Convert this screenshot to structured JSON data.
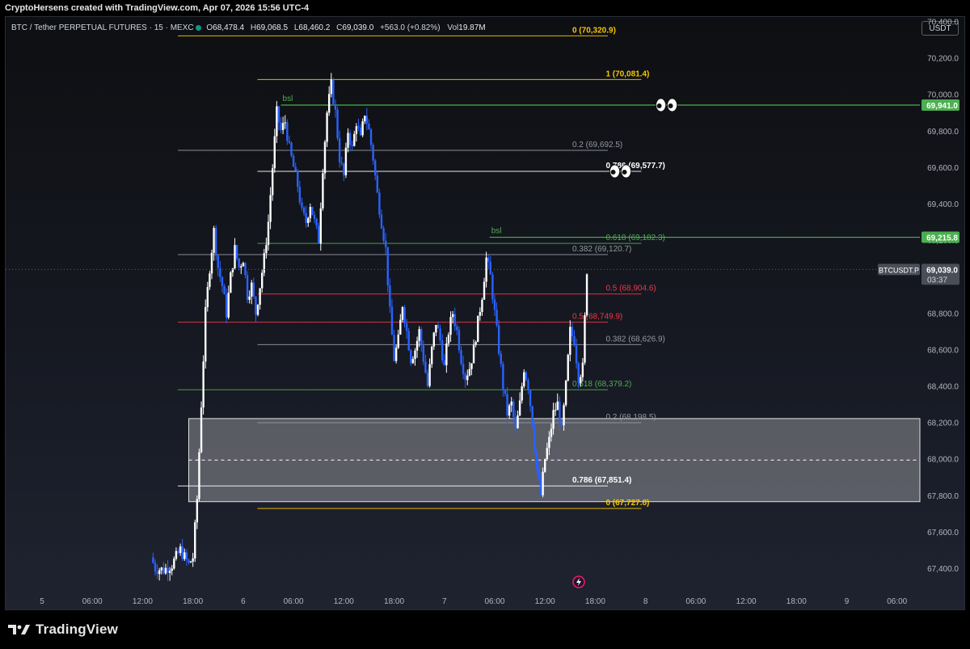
{
  "attribution": "CryptoHersens created with TradingView.com, Apr 07, 2026 15:56 UTC-4",
  "symbol_bar": {
    "symbol": "BTC / Tether PERPETUAL FUTURES · 15 · MEXC",
    "open_label": "O",
    "open": "68,478.4",
    "high_label": "H",
    "high": "69,068.5",
    "low_label": "L",
    "low": "68,460.2",
    "close_label": "C",
    "close": "69,039.0",
    "change": "+563.0 (+0.82%)",
    "vol_label": "Vol",
    "volume": "19.87M"
  },
  "currency": "USDT",
  "logo_text": "TradingView",
  "colors": {
    "candle_up": "#ffffff",
    "candle_down": "#2962ff",
    "fib_yellow": "#f7c600",
    "fib_green": "#4caf50",
    "fib_red": "#f23645",
    "fib_gray": "#9598a1",
    "price_tag_green": "#4caf50"
  },
  "chart_data": {
    "type": "candlestick",
    "title": "BTC / Tether PERPETUAL FUTURES · 15 · MEXC",
    "interval": "15m",
    "x_tick_labels": [
      "5",
      "06:00",
      "12:00",
      "18:00",
      "6",
      "06:00",
      "12:00",
      "18:00",
      "7",
      "06:00",
      "12:00",
      "18:00",
      "8",
      "06:00",
      "12:00",
      "18:00",
      "9",
      "06:00"
    ],
    "y_tick_labels": [
      "70,400.0",
      "70,200.0",
      "70,000.0",
      "69,800.0",
      "69,600.0",
      "69,400.0",
      "69,200.0",
      "69,000.0",
      "68,800.0",
      "68,600.0",
      "68,400.0",
      "68,200.0",
      "68,000.0",
      "67,800.0",
      "67,600.0",
      "67,400.0"
    ],
    "ylim": [
      67320,
      70480
    ],
    "xlim_hours": [
      0,
      102
    ],
    "current_price": {
      "symbol": "BTCUSDT.P",
      "price": "69,039.0",
      "countdown": "03:37",
      "value": 69039.0
    },
    "price_tags": [
      {
        "label": "69,941.0",
        "value": 69941.0
      },
      {
        "label": "69,215.8",
        "value": 69215.8
      }
    ],
    "horizontal_lines": [
      {
        "label": "bsl",
        "value": 69941.0,
        "color": "green",
        "from_hour": 28.5
      },
      {
        "label": "bsl",
        "value": 69215.8,
        "color": "green",
        "from_hour": 53.4
      }
    ],
    "fib_levels": [
      {
        "label": "0 (70,320.9)",
        "value": 70320.9,
        "color": "yellow",
        "x1": 16.2,
        "x2": 67.5
      },
      {
        "label": "1 (70,081.4)",
        "value": 70081.4,
        "color": "yellow",
        "x1": 25.7,
        "x2": 71.5
      },
      {
        "label": "0.2 (69,692.5)",
        "value": 69692.5,
        "color": "gray",
        "x1": 16.2,
        "x2": 67.5
      },
      {
        "label": "0.786 (69,577.7)",
        "value": 69577.7,
        "color": "white",
        "x1": 25.7,
        "x2": 71.5
      },
      {
        "label": "0.618 (69,182.3)",
        "value": 69182.3,
        "color": "green",
        "x1": 25.7,
        "x2": 71.5
      },
      {
        "label": "0.382 (69,120.7)",
        "value": 69120.7,
        "color": "gray",
        "x1": 16.2,
        "x2": 67.5
      },
      {
        "label": "0.5 (68,904.6)",
        "value": 68904.6,
        "color": "red",
        "x1": 25.7,
        "x2": 71.5
      },
      {
        "label": "0.5 (68,749.9)",
        "value": 68749.9,
        "color": "red",
        "x1": 16.2,
        "x2": 67.5
      },
      {
        "label": "0.382 (68,626.9)",
        "value": 68626.9,
        "color": "gray",
        "x1": 25.7,
        "x2": 71.5
      },
      {
        "label": "0.618 (68,379.2)",
        "value": 68379.2,
        "color": "green",
        "x1": 16.2,
        "x2": 67.5
      },
      {
        "label": "0.2 (68,198.5)",
        "value": 68198.5,
        "color": "gray",
        "x1": 25.7,
        "x2": 71.5
      },
      {
        "label": "0.786 (67,851.4)",
        "value": 67851.4,
        "color": "white",
        "x1": 16.2,
        "x2": 67.5
      },
      {
        "label": "0 (67,727.8)",
        "value": 67727.8,
        "color": "yellow",
        "x1": 25.7,
        "x2": 71.5
      }
    ],
    "zone": {
      "top": 68221,
      "bottom": 67765,
      "mid": 67993,
      "from_hour": 17.5
    },
    "emoji_markers": [
      {
        "glyph": "👀",
        "value": 69941.0,
        "hour": 74.5
      },
      {
        "glyph": "👀",
        "value": 69577.7,
        "hour": 69.0
      }
    ],
    "candles_close_path": [
      [
        13.0,
        67460
      ],
      [
        13.5,
        67400
      ],
      [
        14.5,
        67390
      ],
      [
        15.5,
        67420
      ],
      [
        16.5,
        67500
      ],
      [
        17.5,
        67420
      ],
      [
        18.0,
        67460
      ],
      [
        18.5,
        67780
      ],
      [
        19.0,
        68300
      ],
      [
        19.5,
        68800
      ],
      [
        20.0,
        69050
      ],
      [
        20.5,
        69250
      ],
      [
        21.0,
        69050
      ],
      [
        21.5,
        68950
      ],
      [
        22.0,
        68800
      ],
      [
        22.5,
        69000
      ],
      [
        23.0,
        69150
      ],
      [
        23.5,
        69050
      ],
      [
        24.0,
        69100
      ],
      [
        24.5,
        68900
      ],
      [
        25.0,
        68950
      ],
      [
        25.5,
        68800
      ],
      [
        26.0,
        68950
      ],
      [
        26.5,
        69100
      ],
      [
        27.0,
        69300
      ],
      [
        27.5,
        69600
      ],
      [
        28.0,
        69900
      ],
      [
        28.5,
        69800
      ],
      [
        29.0,
        69850
      ],
      [
        29.5,
        69700
      ],
      [
        30.0,
        69600
      ],
      [
        30.5,
        69500
      ],
      [
        31.0,
        69350
      ],
      [
        31.5,
        69300
      ],
      [
        32.0,
        69400
      ],
      [
        32.5,
        69300
      ],
      [
        33.0,
        69200
      ],
      [
        33.5,
        69600
      ],
      [
        34.0,
        69900
      ],
      [
        34.5,
        70050
      ],
      [
        35.0,
        69900
      ],
      [
        35.5,
        69650
      ],
      [
        36.0,
        69550
      ],
      [
        36.5,
        69800
      ],
      [
        37.0,
        69700
      ],
      [
        37.5,
        69850
      ],
      [
        38.0,
        69750
      ],
      [
        38.5,
        69900
      ],
      [
        39.0,
        69800
      ],
      [
        39.5,
        69650
      ],
      [
        40.0,
        69450
      ],
      [
        40.5,
        69300
      ],
      [
        41.0,
        69150
      ],
      [
        41.5,
        68800
      ],
      [
        42.0,
        68550
      ],
      [
        42.5,
        68650
      ],
      [
        43.0,
        68850
      ],
      [
        43.5,
        68700
      ],
      [
        44.0,
        68550
      ],
      [
        44.5,
        68600
      ],
      [
        45.0,
        68700
      ],
      [
        45.5,
        68550
      ],
      [
        46.0,
        68400
      ],
      [
        46.5,
        68600
      ],
      [
        47.0,
        68750
      ],
      [
        47.5,
        68650
      ],
      [
        48.0,
        68500
      ],
      [
        48.5,
        68700
      ],
      [
        49.0,
        68800
      ],
      [
        49.5,
        68700
      ],
      [
        50.0,
        68550
      ],
      [
        50.5,
        68450
      ],
      [
        51.0,
        68500
      ],
      [
        51.5,
        68600
      ],
      [
        52.0,
        68750
      ],
      [
        52.5,
        68900
      ],
      [
        53.0,
        69100
      ],
      [
        53.5,
        69000
      ],
      [
        54.0,
        68800
      ],
      [
        54.5,
        68600
      ],
      [
        55.0,
        68400
      ],
      [
        55.5,
        68250
      ],
      [
        56.0,
        68300
      ],
      [
        56.5,
        68150
      ],
      [
        57.0,
        68300
      ],
      [
        57.5,
        68500
      ],
      [
        58.0,
        68400
      ],
      [
        58.5,
        68200
      ],
      [
        59.0,
        67950
      ],
      [
        59.5,
        67800
      ],
      [
        60.0,
        68000
      ],
      [
        60.5,
        68100
      ],
      [
        61.0,
        68250
      ],
      [
        61.5,
        68300
      ],
      [
        62.0,
        68150
      ],
      [
        62.5,
        68400
      ],
      [
        63.0,
        68700
      ],
      [
        63.5,
        68650
      ],
      [
        64.0,
        68450
      ],
      [
        64.5,
        68500
      ],
      [
        65.0,
        69039
      ]
    ]
  }
}
